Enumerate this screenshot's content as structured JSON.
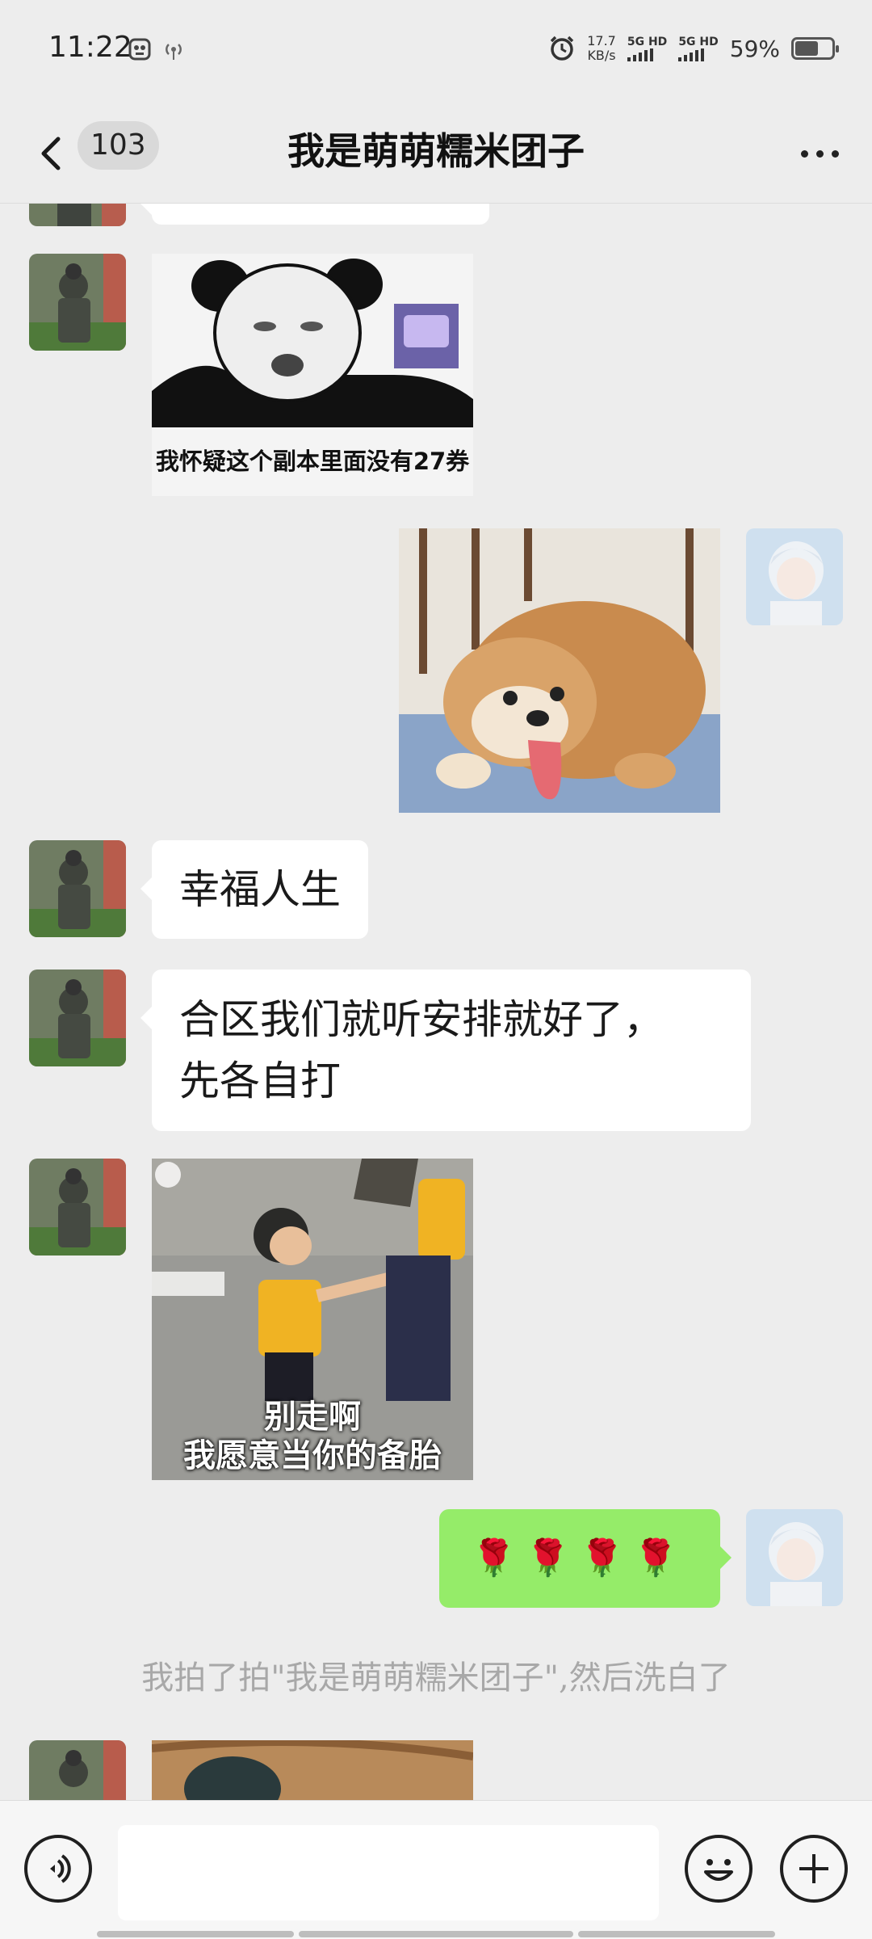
{
  "status_bar": {
    "time": "11:22",
    "net_speed_value": "17.7",
    "net_speed_unit": "KB/s",
    "sim1_label": "5G HD",
    "sim2_label": "5G HD",
    "battery_text": "59%",
    "battery_level": 0.59
  },
  "header": {
    "unread_count": "103",
    "title": "我是萌萌糯米团子"
  },
  "messages": {
    "sticker_panda_caption": "我怀疑这个副本里面没有27券",
    "text_1": "幸福人生",
    "text_2_line1": "合区我们就听安排就好了，",
    "text_2_line2": "先各自打",
    "sticker_kids_caption_line1": "别走啊",
    "sticker_kids_caption_line2": "我愿意当你的备胎",
    "roses": "🌹🌹🌹🌹",
    "system_notice": "我拍了拍\"我是萌萌糯米团子\",然后洗白了"
  },
  "input": {
    "placeholder": ""
  },
  "icons": {
    "back": "chevron-left-icon",
    "more": "ellipsis-icon",
    "voice": "voice-icon",
    "emoji": "emoji-icon",
    "plus": "plus-icon"
  },
  "colors": {
    "background": "#ededed",
    "bubble_white": "#ffffff",
    "bubble_green": "#95ec69",
    "system_text": "#a8a8a8"
  }
}
